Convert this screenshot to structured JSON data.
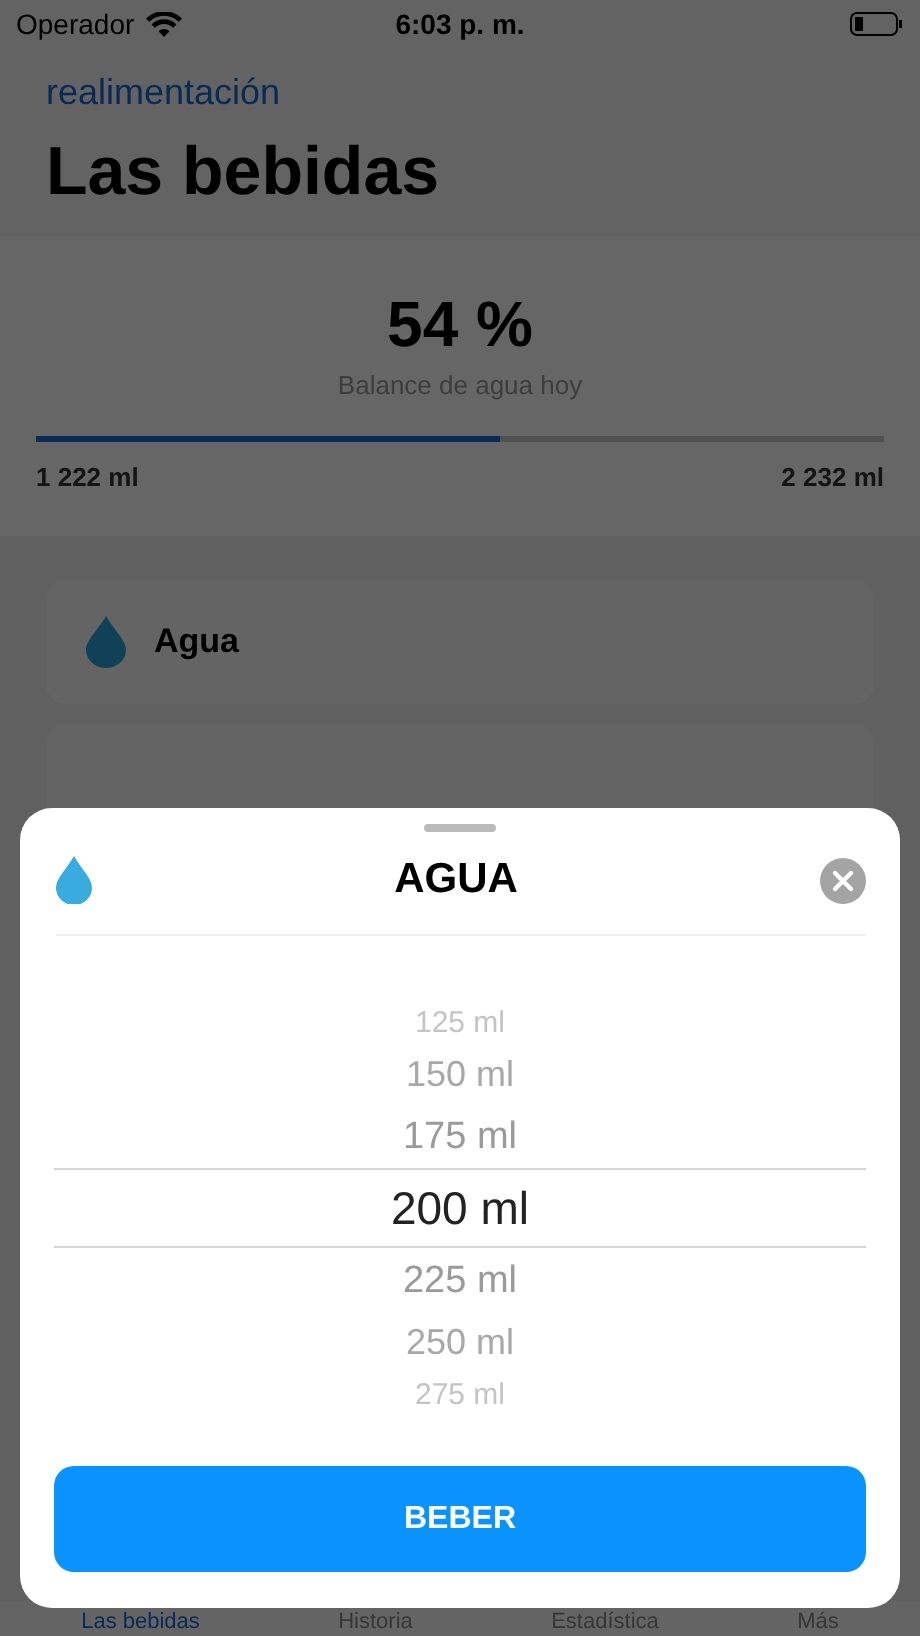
{
  "status_bar": {
    "carrier": "Operador",
    "time": "6:03 p. m."
  },
  "nav": {
    "back_link": "realimentación",
    "title": "Las bebidas"
  },
  "summary": {
    "percent": "54 %",
    "caption": "Balance de agua hoy",
    "level": 0.547,
    "current": "1 222 ml",
    "goal": "2 232 ml"
  },
  "drinks": [
    {
      "name": "Agua"
    }
  ],
  "tab_bar": [
    {
      "label": "Las bebidas",
      "selected": true
    },
    {
      "label": "Historia",
      "selected": false
    },
    {
      "label": "Estadística",
      "selected": false
    },
    {
      "label": "Más",
      "selected": false
    }
  ],
  "sheet": {
    "title": "AGUA",
    "picker": [
      {
        "value": "125 ml",
        "selected": false
      },
      {
        "value": "150 ml",
        "selected": false
      },
      {
        "value": "175 ml",
        "selected": false
      },
      {
        "value": "200 ml",
        "selected": true
      },
      {
        "value": "225 ml",
        "selected": false
      },
      {
        "value": "250 ml",
        "selected": false
      },
      {
        "value": "275 ml",
        "selected": false
      }
    ],
    "button": "BEBER"
  }
}
